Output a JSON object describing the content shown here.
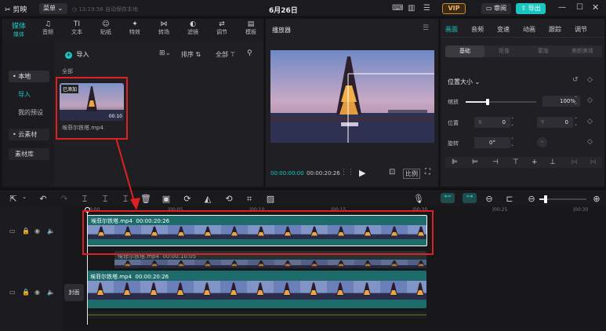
{
  "app": {
    "logo": "剪映",
    "menu_label": "菜单",
    "autosave": "13:19:56 自动保存本地",
    "title": "6月26日",
    "vip": "VIP",
    "review": "审阅",
    "export": "导出"
  },
  "toolbar_tabs": [
    "媒体",
    "音频",
    "文本",
    "贴纸",
    "特效",
    "转场",
    "滤镜",
    "调节",
    "模板"
  ],
  "toolbar_icons": [
    "媒体",
    "♫",
    "TI",
    "☺",
    "✦",
    "⋈",
    "◐",
    "⇄",
    "▤"
  ],
  "sidebar": {
    "items": [
      "• 本地",
      "导入",
      "我的预设",
      "• 云素材",
      "素材库"
    ]
  },
  "media": {
    "import_label": "导入",
    "sort_label": "排序",
    "all_filter": "全部",
    "section_all": "全部",
    "clip": {
      "badge": "已添加",
      "name": "埃菲尔铁塔.mp4",
      "duration": "00:10"
    }
  },
  "player": {
    "title": "播放器",
    "current": "00:00:00:00",
    "total": "00:00:20:26",
    "ratio": "比例"
  },
  "inspector": {
    "tabs": [
      "画面",
      "音频",
      "变速",
      "动画",
      "跟踪",
      "调节"
    ],
    "subtabs": [
      "基础",
      "抠像",
      "蒙版",
      "美颜美体"
    ],
    "section": "位置大小",
    "scale_label": "缩放",
    "scale_value": "100%",
    "position_label": "位置",
    "x_label": "X",
    "x_value": "0",
    "y_label": "Y",
    "y_value": "0",
    "rotate_label": "旋转",
    "rotate_value": "0°"
  },
  "timeline": {
    "ruler_labels": [
      "00:00",
      "|00:05",
      "|00:10",
      "|00:15",
      "|00:20",
      "|00:25",
      "|00:30"
    ],
    "clip_top": {
      "name": "埃菲尔铁塔.mp4",
      "duration": "00:00:20:26"
    },
    "clip_ghost": {
      "name": "埃菲尔铁塔.mp4",
      "duration": "00:00:10:05"
    },
    "clip_main": {
      "name": "埃菲尔铁塔.mp4",
      "duration": "00:00:20:26"
    },
    "cover_label": "封面"
  },
  "colors": {
    "accent": "#19c7c0",
    "highlight": "#e02020",
    "clip": "#1e6b6c"
  }
}
